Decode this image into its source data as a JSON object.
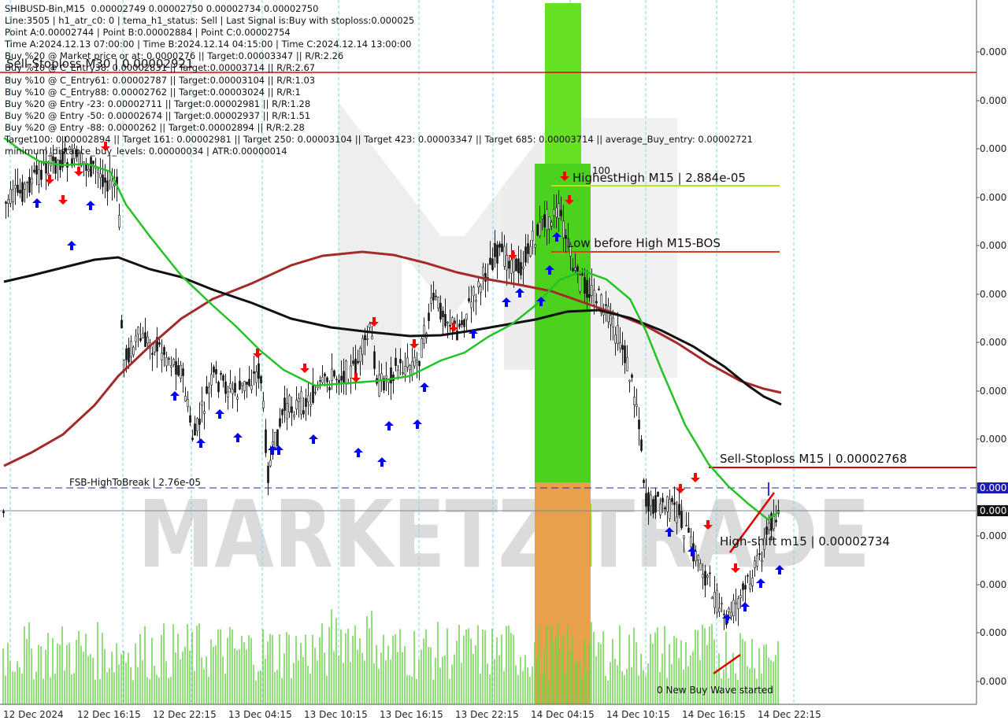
{
  "header": {
    "lines": [
      "SHIBUSD-Bin,M15  0.00002749 0.00002750 0.00002734 0.00002750",
      "Line:3505 | h1_atr_c0: 0 | tema_h1_status: Sell | Last Signal is:Buy with stoploss:0.000025",
      "Point A:0.00002744 | Point B:0.00002884 | Point C:0.00002754",
      "Time A:2024.12.13 07:00:00 | Time B:2024.12.14 04:15:00 | Time C:2024.12.14 13:00:00",
      "Buy %20 @ Market price or at: 0.0000276 || Target:0.00003347 || R/R:2.26",
      "Buy %10 @ C_Entry38: 0.00002831 || Target:0.00003714 || R/R:2.67",
      "Buy %10 @ C_Entry61: 0.00002787 || Target:0.00003104 || R/R:1.03",
      "Buy %10 @ C_Entry88: 0.00002762 || Target:0.00003024 || R/R:1",
      "Buy %20 @ Entry -23: 0.00002711 || Target:0.00002981 || R/R:1.28",
      "Buy %20 @ Entry -50: 0.00002674 || Target:0.00002937 || R/R:1.51",
      "Buy %20 @ Entry -88: 0.0000262 || Target:0.00002894 || R/R:2.28",
      "Target100: 0.00002894 || Target 161: 0.00002981 || Target 250: 0.00003104 || Target 423: 0.00003347 || Target 685: 0.00003714 || average_Buy_entry: 0.00002721",
      "minimum_distance_buy_levels: 0.00000034 | ATR:0.00000014"
    ]
  },
  "watermark": "MARKETZITRADE",
  "annotations": {
    "sell_stoploss_m30": "Sell-Stoploss M30 | 0.00002921",
    "highest_high": "HighestHigh   M15 | 2.884e-05",
    "highest_high_tag": "100",
    "low_before_high": "Low before High   M15-BOS",
    "sell_stoploss_m15": "Sell-Stoploss M15 | 0.00002768",
    "fsb": "FSB-HighToBreak | 2.76e-05",
    "high_shift": "High-shift m15 | 0.00002734",
    "new_wave": "0 New Buy Wave started"
  },
  "price_axis": {
    "labels": [
      "0.000",
      "0.000",
      "0.000",
      "0.000",
      "0.000",
      "0.000",
      "0.000",
      "0.000",
      "0.000",
      "0.000",
      "0.000",
      "0.000",
      "0.000",
      "0.000"
    ],
    "current_tags": [
      "0.000",
      "0.000"
    ]
  },
  "time_axis": {
    "labels": [
      "12 Dec 2024",
      "12 Dec 16:15",
      "12 Dec 22:15",
      "13 Dec 04:15",
      "13 Dec 10:15",
      "13 Dec 16:15",
      "13 Dec 22:15",
      "14 Dec 04:15",
      "14 Dec 10:15",
      "14 Dec 16:15",
      "14 Dec 22:15"
    ]
  },
  "colors": {
    "up_arrow": "#0000ff",
    "down_arrow": "#ff0000",
    "ma_green": "#22c322",
    "ma_red": "#a52a2a",
    "ma_black": "#000000",
    "green_zone": "#4cd11f",
    "orange_zone": "#e8a04a",
    "level_red": "#e00000"
  }
}
